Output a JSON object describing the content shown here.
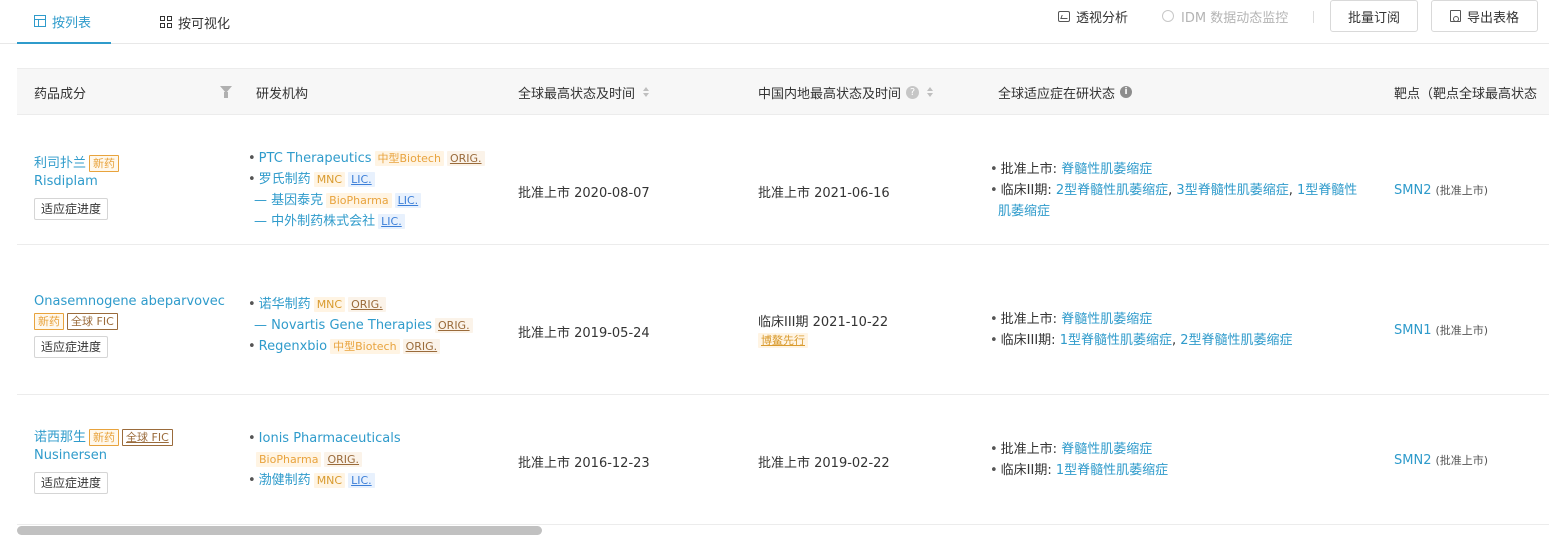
{
  "tabs": [
    {
      "label": "按列表",
      "icon": "table-icon",
      "active": true
    },
    {
      "label": "按可视化",
      "icon": "grid-icon",
      "active": false
    }
  ],
  "toolbar": {
    "pivot": "透视分析",
    "idm": "IDM 数据动态监控",
    "batch": "批量订阅",
    "export": "导出表格"
  },
  "columns": {
    "drug": "药品成分",
    "org": "研发机构",
    "global_status": "全球最高状态及时间",
    "china_status": "中国内地最高状态及时间",
    "indication": "全球适应症在研状态",
    "target": "靶点（靶点全球最高状态"
  },
  "rows": [
    {
      "drug_cn": "利司扑兰",
      "drug_tags": [
        "新药"
      ],
      "drug_en": "Risdiplam",
      "progress_btn": "适应症进度",
      "orgs": [
        {
          "name": "PTC Therapeutics",
          "level": 0,
          "tags": [
            "中型Biotech",
            "ORIG."
          ]
        },
        {
          "name": "罗氏制药",
          "level": 0,
          "tags": [
            "MNC",
            "LIC."
          ]
        },
        {
          "name": "基因泰克",
          "level": 1,
          "tags": [
            "BioPharma",
            "LIC."
          ]
        },
        {
          "name": "中外制药株式会社",
          "level": 1,
          "tags": [
            "LIC."
          ]
        }
      ],
      "global_status": "批准上市 2020-08-07",
      "china_status": "批准上市 2021-06-16",
      "china_tag": "",
      "indications": [
        {
          "label": "批准上市:",
          "items": [
            "脊髓性肌萎缩症"
          ]
        },
        {
          "label": "临床II期:",
          "items": [
            "2型脊髓性肌萎缩症",
            "3型脊髓性肌萎缩症",
            "1型脊髓性肌萎缩症"
          ]
        }
      ],
      "target": "SMN2",
      "target_status": "(批准上市)"
    },
    {
      "drug_cn": "Onasemnogene abeparvovec",
      "drug_tags": [
        "新药",
        "全球 FIC"
      ],
      "drug_en": "",
      "progress_btn": "适应症进度",
      "orgs": [
        {
          "name": "诺华制药",
          "level": 0,
          "tags": [
            "MNC",
            "ORIG."
          ]
        },
        {
          "name": "Novartis Gene Therapies",
          "level": 1,
          "tags": [
            "ORIG."
          ]
        },
        {
          "name": "Regenxbio",
          "level": 0,
          "tags": [
            "中型Biotech",
            "ORIG."
          ]
        }
      ],
      "global_status": "批准上市 2019-05-24",
      "china_status": "临床III期 2021-10-22",
      "china_tag": "博鳌先行",
      "indications": [
        {
          "label": "批准上市:",
          "items": [
            "脊髓性肌萎缩症"
          ]
        },
        {
          "label": "临床III期:",
          "items": [
            "1型脊髓性肌萎缩症",
            "2型脊髓性肌萎缩症"
          ]
        }
      ],
      "target": "SMN1",
      "target_status": "(批准上市)"
    },
    {
      "drug_cn": "诺西那生",
      "drug_tags": [
        "新药",
        "全球 FIC"
      ],
      "drug_en": "Nusinersen",
      "progress_btn": "适应症进度",
      "orgs": [
        {
          "name": "Ionis Pharmaceuticals",
          "level": 0,
          "tags": []
        },
        {
          "name": "",
          "level": 2,
          "tags": [
            "BioPharma",
            "ORIG."
          ]
        },
        {
          "name": "渤健制药",
          "level": 0,
          "tags": [
            "MNC",
            "LIC."
          ]
        }
      ],
      "global_status": "批准上市 2016-12-23",
      "china_status": "批准上市 2019-02-22",
      "china_tag": "",
      "indications": [
        {
          "label": "批准上市:",
          "items": [
            "脊髓性肌萎缩症"
          ]
        },
        {
          "label": "临床II期:",
          "items": [
            "1型脊髓性肌萎缩症"
          ]
        }
      ],
      "target": "SMN2",
      "target_status": "(批准上市)"
    }
  ]
}
